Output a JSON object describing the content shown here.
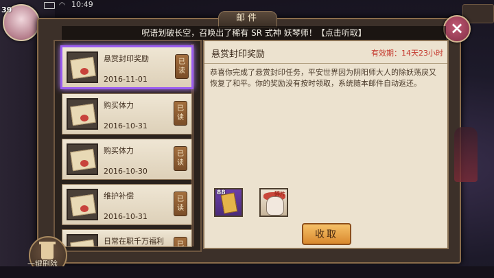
{
  "status_bar": {
    "time": "10:49",
    "level": "39"
  },
  "window": {
    "title": "邮件"
  },
  "announcement": "呪语划破长空，召唤出了稀有 SR 式神 妖琴师！【点击听取】",
  "mail_list": [
    {
      "title": "悬赏封印奖励",
      "date": "2016-11-01",
      "read": "已读",
      "selected": true
    },
    {
      "title": "购买体力",
      "date": "2016-10-31",
      "read": "已读",
      "selected": false
    },
    {
      "title": "购买体力",
      "date": "2016-10-30",
      "read": "已读",
      "selected": false
    },
    {
      "title": "维护补偿",
      "date": "2016-10-31",
      "read": "已读",
      "selected": false
    },
    {
      "title": "日常在职千万福利",
      "date": "",
      "read": "已读",
      "selected": false
    }
  ],
  "detail": {
    "title": "悬赏封印奖励",
    "expiry": "有效期：14天23小时",
    "body": "恭喜你完成了悬赏封印任务，平安世界因为阴阳师大人的除妖荡戾又恢复了和平。你的奖励没有按时领取，系统随本邮件自动返还。",
    "rewards": [
      {
        "name": "reward-talisman",
        "count": "88"
      },
      {
        "name": "reward-shikigami",
        "badge": "碎片"
      }
    ],
    "collect_label": "收取"
  },
  "delete_all_label": "一键删除",
  "colors": {
    "selected_border": "#9a5cf0",
    "expiry_text": "#c4372c",
    "collect_button": "#f0a94a"
  }
}
